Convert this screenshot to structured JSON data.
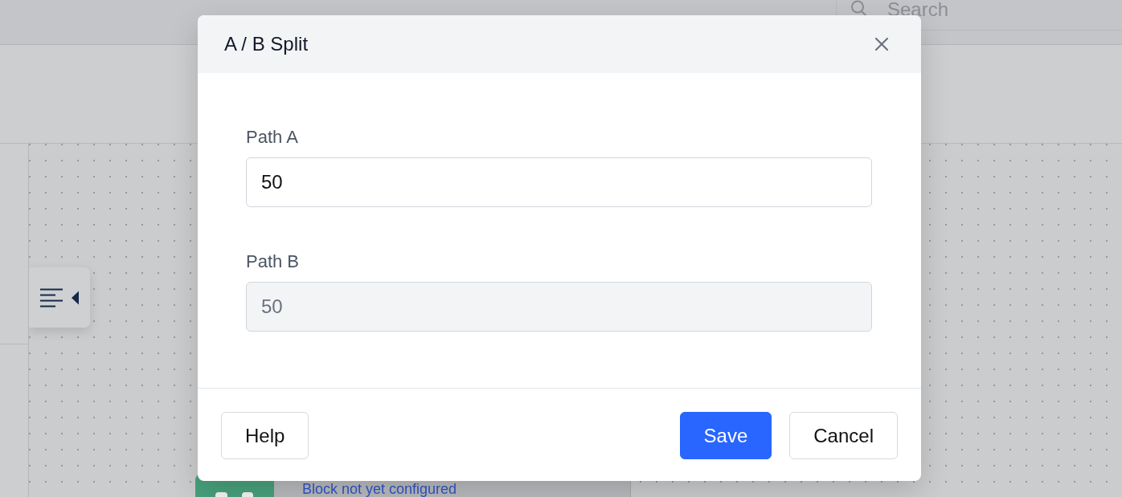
{
  "header": {
    "search": {
      "placeholder": "Search"
    }
  },
  "canvas": {
    "block": {
      "status": "Block not yet configured"
    }
  },
  "dialog": {
    "title": "A / B Split",
    "fields": [
      {
        "label": "Path A",
        "value": "50",
        "disabled": false
      },
      {
        "label": "Path B",
        "value": "50",
        "disabled": true
      }
    ],
    "footer": {
      "start": [
        {
          "label": "Help",
          "kind": "default"
        }
      ],
      "end": [
        {
          "label": "Save",
          "kind": "primary"
        },
        {
          "label": "Cancel",
          "kind": "default"
        }
      ]
    }
  }
}
